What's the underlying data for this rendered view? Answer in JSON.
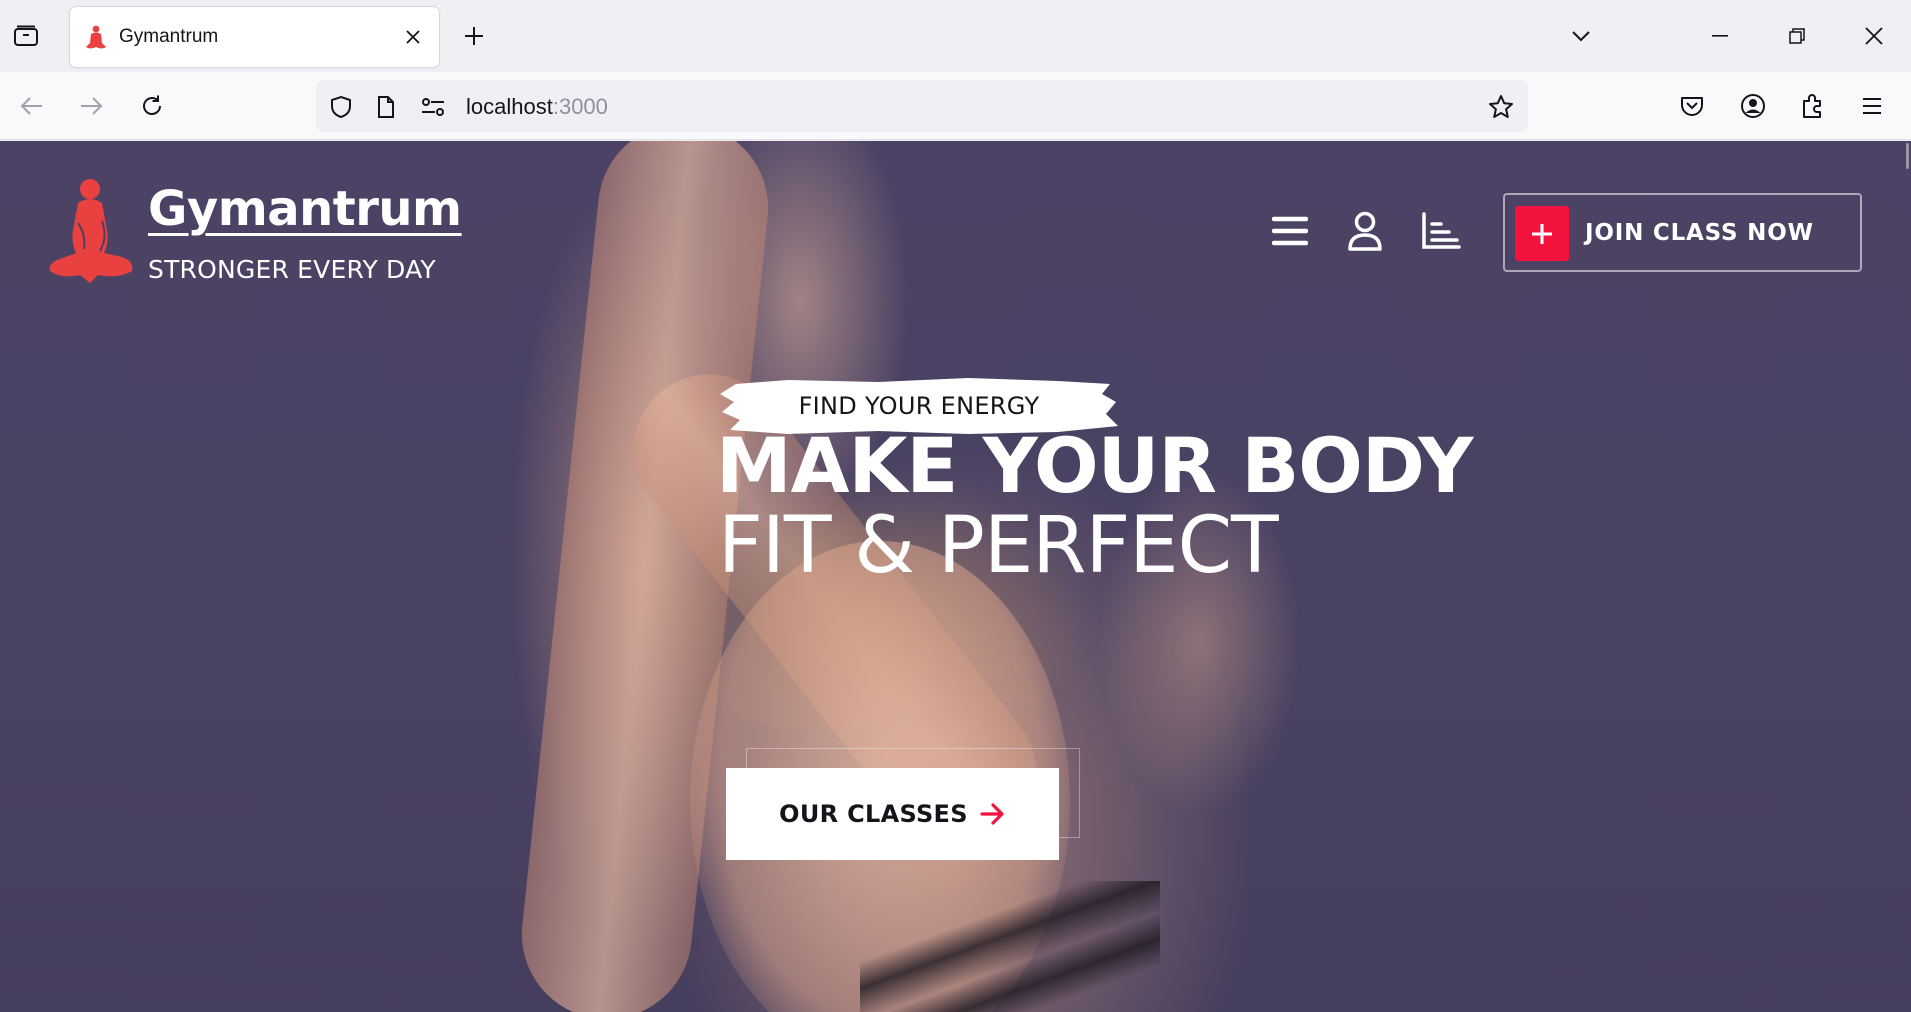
{
  "browser": {
    "tab": {
      "title": "Gymantrum"
    },
    "url": {
      "host": "localhost",
      "port": ":3000"
    }
  },
  "site": {
    "brand": {
      "name": "Gymantrum",
      "tagline": "STRONGER EVERY DAY"
    },
    "cta": {
      "join_label": "JOIN CLASS NOW"
    },
    "hero": {
      "eyebrow": "FIND YOUR ENERGY",
      "headline_1": "MAKE YOUR BODY",
      "headline_2": "FIT & PERFECT",
      "button_label": "OUR CLASSES"
    },
    "colors": {
      "accent": "#f4123f",
      "hero_bg": "#4a4163",
      "logo": "#e8413f"
    }
  }
}
